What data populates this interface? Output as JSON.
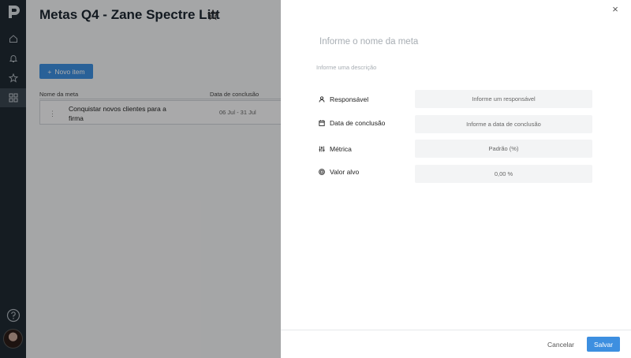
{
  "page": {
    "title": "Metas Q4 - Zane Spectre Litt",
    "new_item_label": "Novo item",
    "new_item_icon": "+",
    "columns": [
      "Nome da meta",
      "Data de conclusão"
    ],
    "rows": [
      {
        "name": "Conquistar novos clientes para a firma",
        "date": "06 Jul - 31 Jul"
      }
    ]
  },
  "sidebar": {
    "items": [
      "home-icon",
      "bell-icon",
      "star-icon",
      "apps-icon"
    ],
    "active_index": 3
  },
  "panel": {
    "title_placeholder": "Informe o nome da meta",
    "description_placeholder": "Informe uma descrição",
    "fields": [
      {
        "label": "Responsável",
        "icon": "user-icon",
        "value": "Informe um responsável"
      },
      {
        "label": "Data de conclusão",
        "icon": "calendar-icon",
        "value": "Informe a data de conclusão"
      },
      {
        "label": "Métrica",
        "icon": "sliders-icon",
        "value": "Padrão (%)"
      },
      {
        "label": "Valor alvo",
        "icon": "target-icon",
        "value": "0,00 %"
      }
    ],
    "close_icon": "×",
    "cancel_label": "Cancelar",
    "save_label": "Salvar"
  },
  "colors": {
    "accent": "#3d8fe0",
    "rail": "#1f2a33"
  }
}
